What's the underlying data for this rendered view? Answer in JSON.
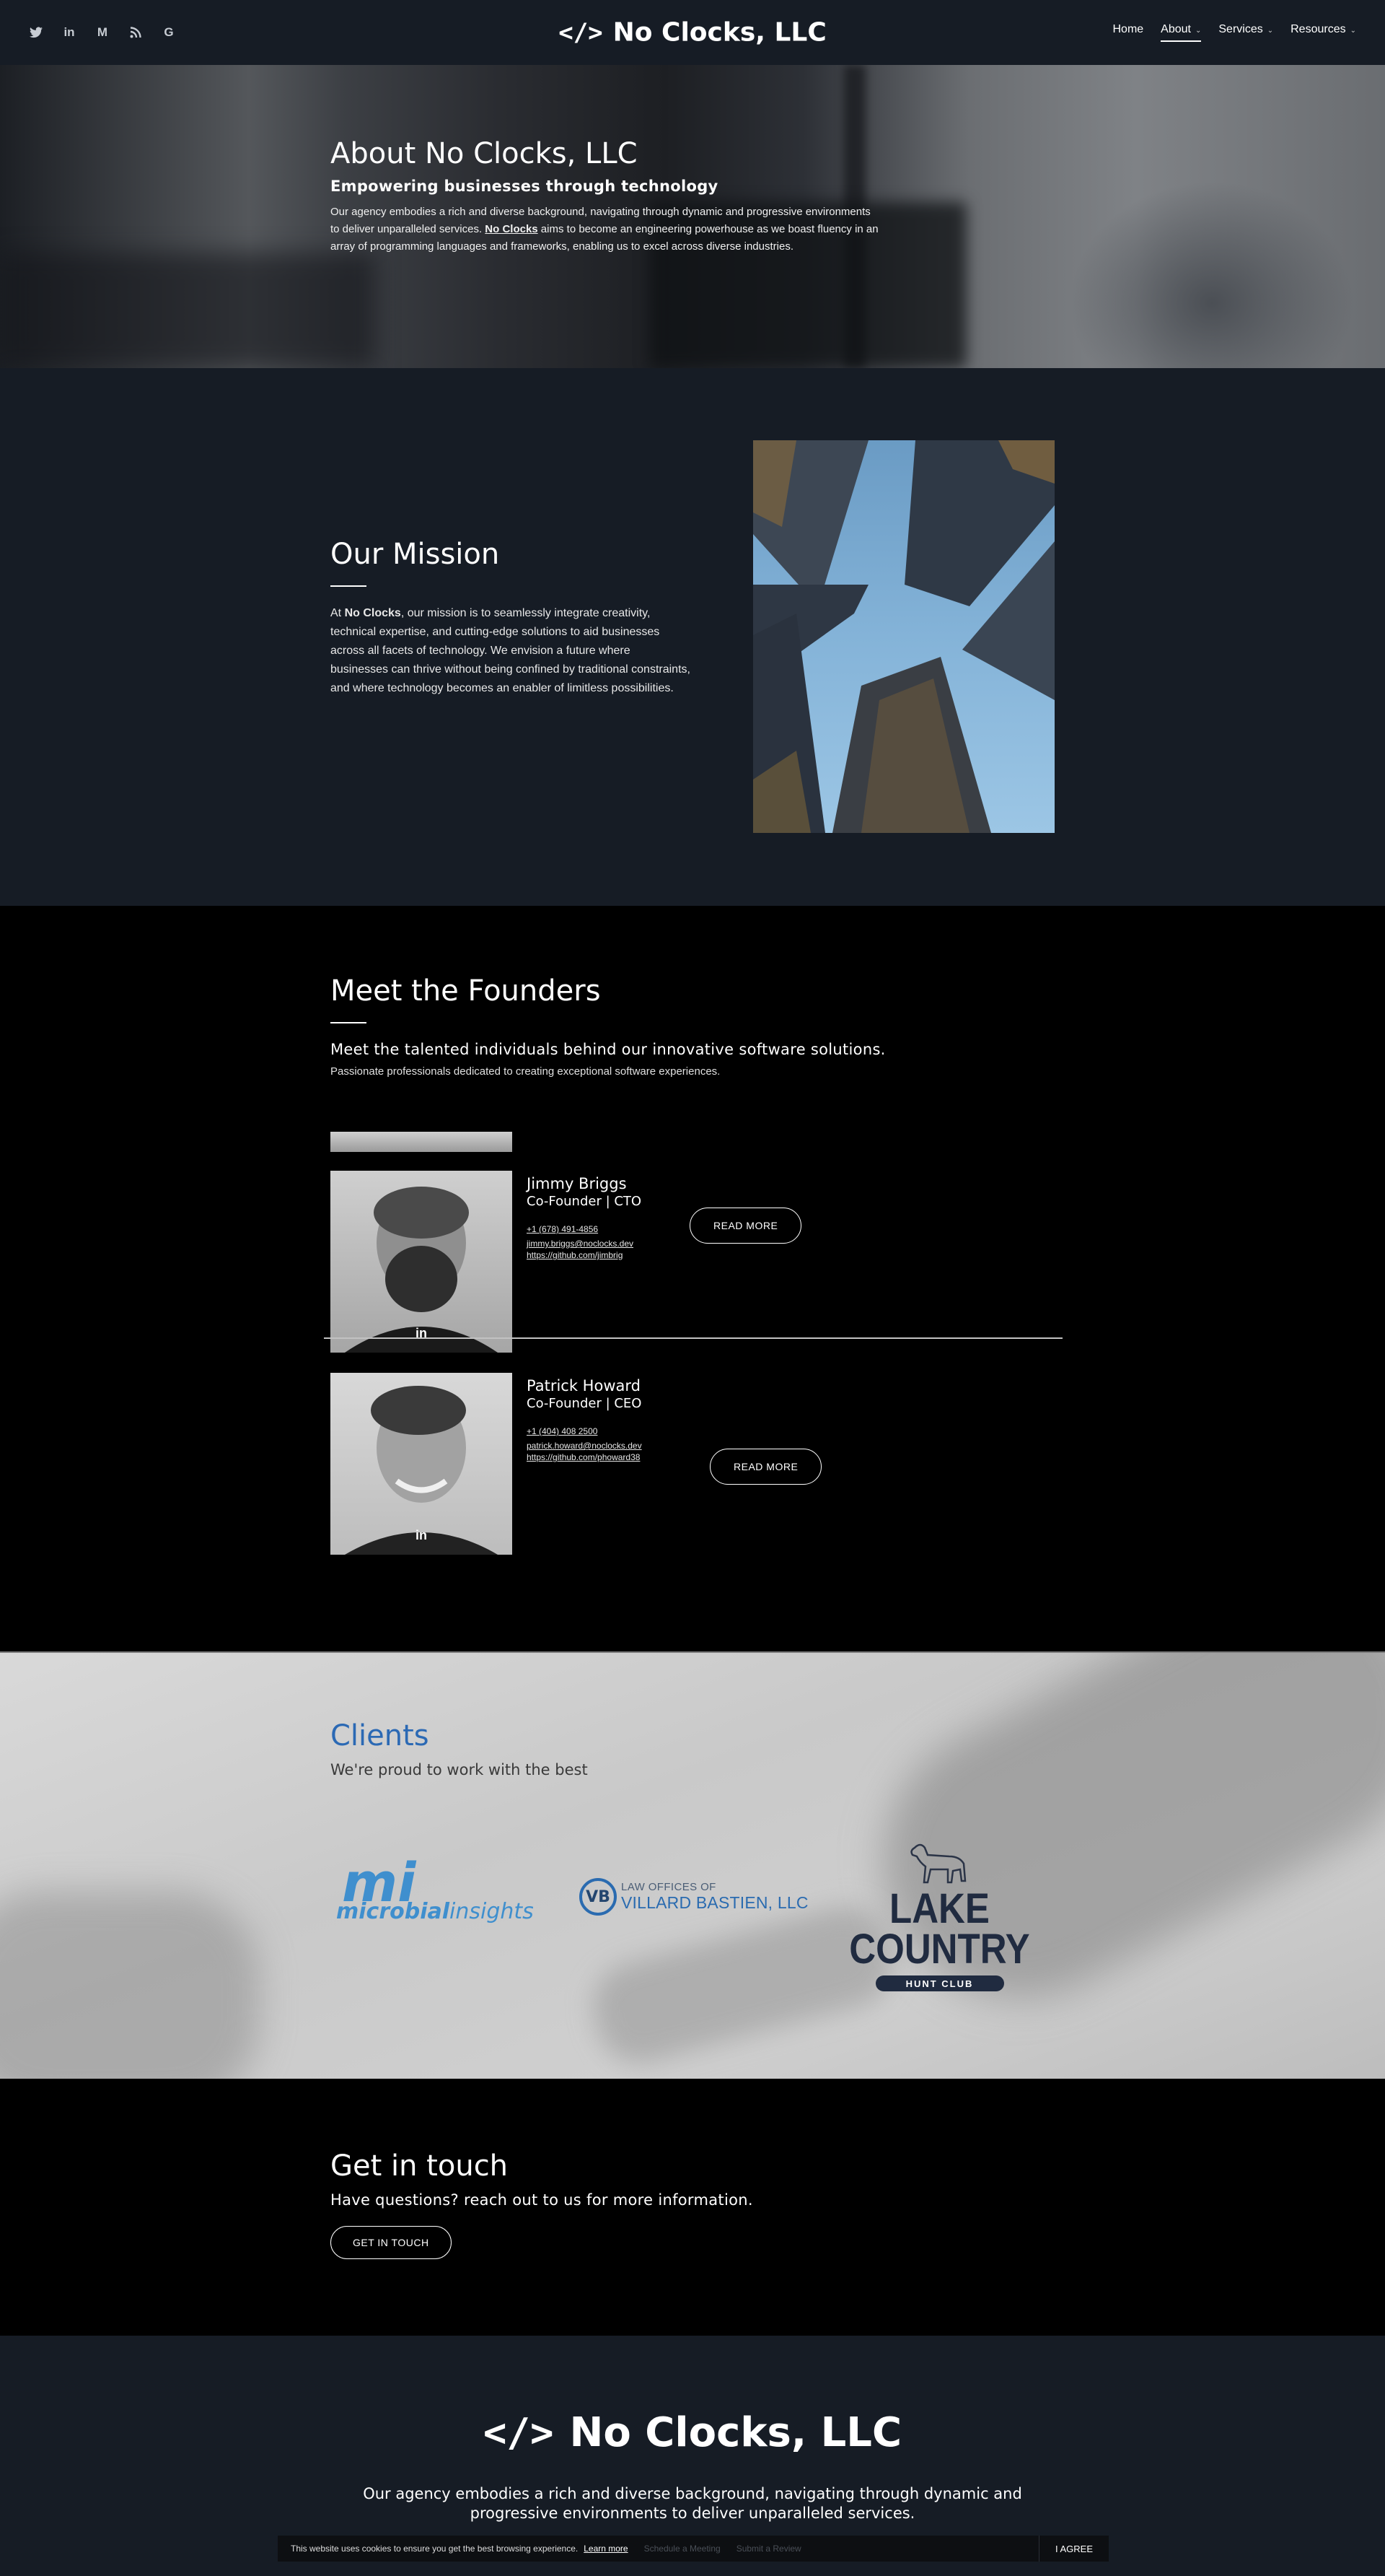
{
  "header": {
    "brand_code": "</>",
    "brand_name": "No Clocks, LLC",
    "social_icons": [
      "twitter-icon",
      "linkedin-icon",
      "medium-icon",
      "rss-icon",
      "google-icon"
    ],
    "nav": [
      {
        "label": "Home"
      },
      {
        "label": "About",
        "active": true
      },
      {
        "label": "Services"
      },
      {
        "label": "Resources"
      }
    ]
  },
  "hero": {
    "title": "About No Clocks, LLC",
    "subtitle": "Empowering businesses through technology",
    "body_1": "Our agency embodies a rich and diverse background, navigating through dynamic and progressive environments to deliver unparalleled services. ",
    "body_link": "No Clocks",
    "body_2": " aims to become an engineering powerhouse as we boast fluency in an array of programming languages and frameworks, enabling us to excel across diverse industries."
  },
  "mission": {
    "title": "Our Mission",
    "body_prefix": "At ",
    "body_bold": "No Clocks",
    "body_rest": ", our mission is to seamlessly integrate creativity, technical expertise, and cutting-edge solutions to aid businesses across all facets of technology. We envision a future where businesses can thrive without being confined by traditional constraints, and where technology becomes an enabler of limitless possibilities."
  },
  "founders": {
    "title": "Meet the Founders",
    "lead": "Meet the talented individuals behind our innovative software solutions.",
    "sub": "Passionate professionals dedicated to creating exceptional software experiences.",
    "people": [
      {
        "name": "Jimmy Briggs",
        "role": "Co-Founder | CTO",
        "phone": "+1 (678) 491-4856",
        "email": "jimmy.briggs@noclocks.dev",
        "github": "https://github.com/jimbrig",
        "button": "READ MORE"
      },
      {
        "name": "Patrick Howard",
        "role": "Co-Founder | CEO",
        "phone": "+1 (404) 408 2500",
        "email": "patrick.howard@noclocks.dev",
        "github": "https://github.com/phoward38",
        "button": "READ MORE"
      }
    ]
  },
  "clients": {
    "title": "Clients",
    "subtitle": "We're proud to work with the best",
    "logos": [
      {
        "big": "mi",
        "word1": "microbial",
        "word2": "insights"
      },
      {
        "mono": "VB",
        "top": "LAW OFFICES OF",
        "main": "VILLARD BASTIEN, LLC"
      },
      {
        "main": "LAKE COUNTRY",
        "badge": "HUNT CLUB"
      }
    ]
  },
  "touch": {
    "title": "Get in touch",
    "subtitle": "Have questions? reach out to us for more information.",
    "button": "GET IN TOUCH"
  },
  "footer": {
    "brand_code": "</>",
    "brand_name": "No Clocks, LLC",
    "text": "Our agency embodies a rich and diverse background, navigating through dynamic and progressive environments to deliver unparalleled services."
  },
  "cookie": {
    "text": "This website uses cookies to ensure you get the best browsing experience.",
    "learn": "Learn more",
    "ghost_1": "Schedule a Meeting",
    "ghost_2": "Submit a Review",
    "agree": "I AGREE"
  }
}
